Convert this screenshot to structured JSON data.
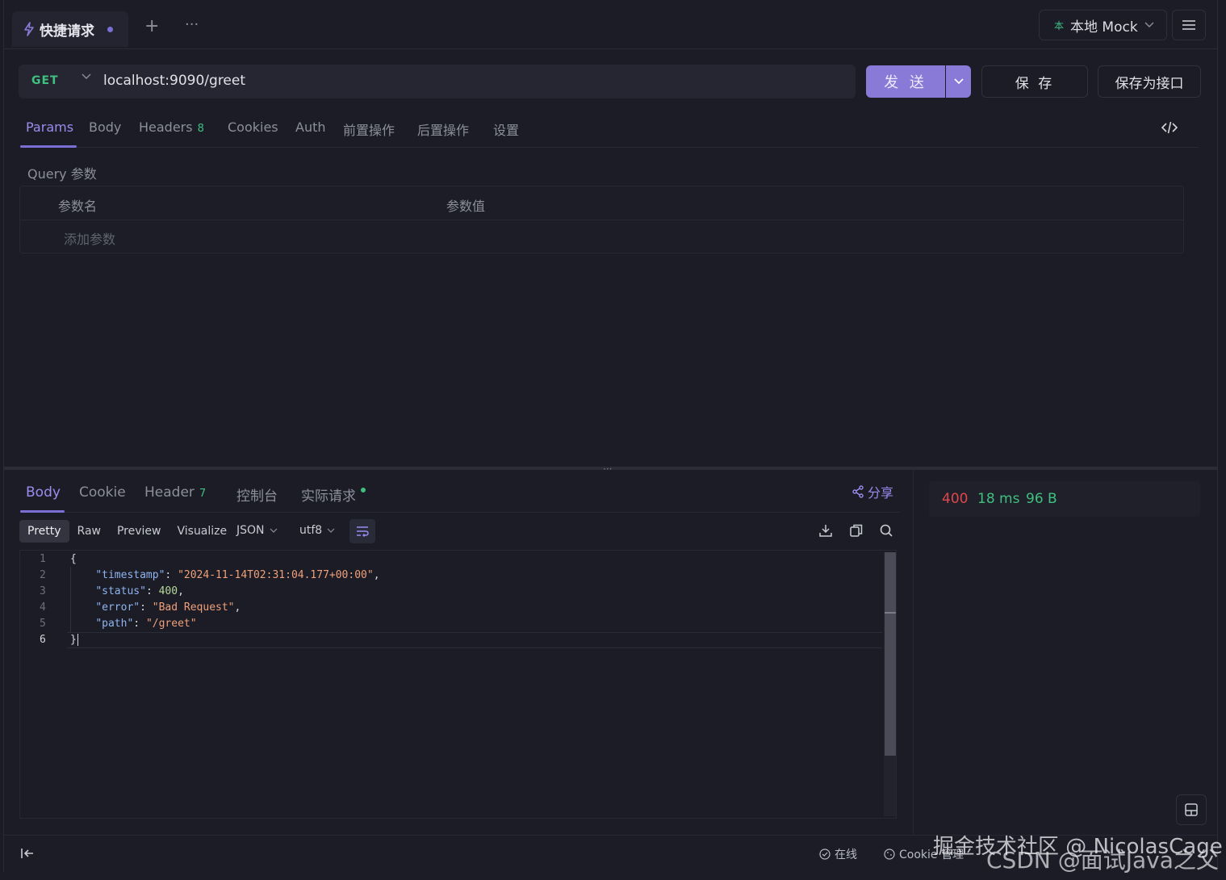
{
  "tabbar": {
    "tab_title": "快捷请求",
    "add_label": "+",
    "more_label": "···",
    "env_mark": "本",
    "env_label": "本地 Mock"
  },
  "request": {
    "method": "GET",
    "url": "localhost:9090/greet",
    "send_label": "发 送",
    "save_label": "保 存",
    "save_as_label": "保存为接口"
  },
  "request_tabs": [
    {
      "label": "Params"
    },
    {
      "label": "Body"
    },
    {
      "label": "Headers",
      "count": "8"
    },
    {
      "label": "Cookies"
    },
    {
      "label": "Auth"
    },
    {
      "label": "前置操作"
    },
    {
      "label": "后置操作"
    },
    {
      "label": "设置"
    }
  ],
  "query": {
    "title": "Query 参数",
    "col_name": "参数名",
    "col_value": "参数值",
    "add_placeholder": "添加参数"
  },
  "response_tabs": [
    {
      "label": "Body"
    },
    {
      "label": "Cookie"
    },
    {
      "label": "Header",
      "count": "7"
    },
    {
      "label": "控制台"
    },
    {
      "label": "实际请求"
    }
  ],
  "share_label": "分享",
  "status": {
    "code": "400",
    "time": "18 ms",
    "size": "96 B"
  },
  "view_modes": [
    "Pretty",
    "Raw",
    "Preview",
    "Visualize"
  ],
  "format": "JSON",
  "encoding": "utf8",
  "editor": {
    "line_numbers": [
      "1",
      "2",
      "3",
      "4",
      "5",
      "6"
    ],
    "lines": [
      {
        "open": "{"
      },
      {
        "key": "\"timestamp\"",
        "value": "\"2024-11-14T02:31:04.177+00:00\"",
        "tail": ","
      },
      {
        "key": "\"status\"",
        "value": "400",
        "tail": ","
      },
      {
        "key": "\"error\"",
        "value": "\"Bad Request\"",
        "tail": ","
      },
      {
        "key": "\"path\"",
        "value": "\"/greet\"",
        "tail": ""
      },
      {
        "close": "}"
      }
    ]
  },
  "statusbar": {
    "online": "在线",
    "cookie": "Cookie 管理"
  },
  "watermark": {
    "line1": "掘金技术社区 @ NicolasCage",
    "line2": "CSDN @面试Java之父"
  },
  "colors": {
    "accent": "#8a7ad8",
    "get_method": "#3fc07f",
    "status_error": "#e0474c",
    "status_ok": "#3fc07f"
  }
}
